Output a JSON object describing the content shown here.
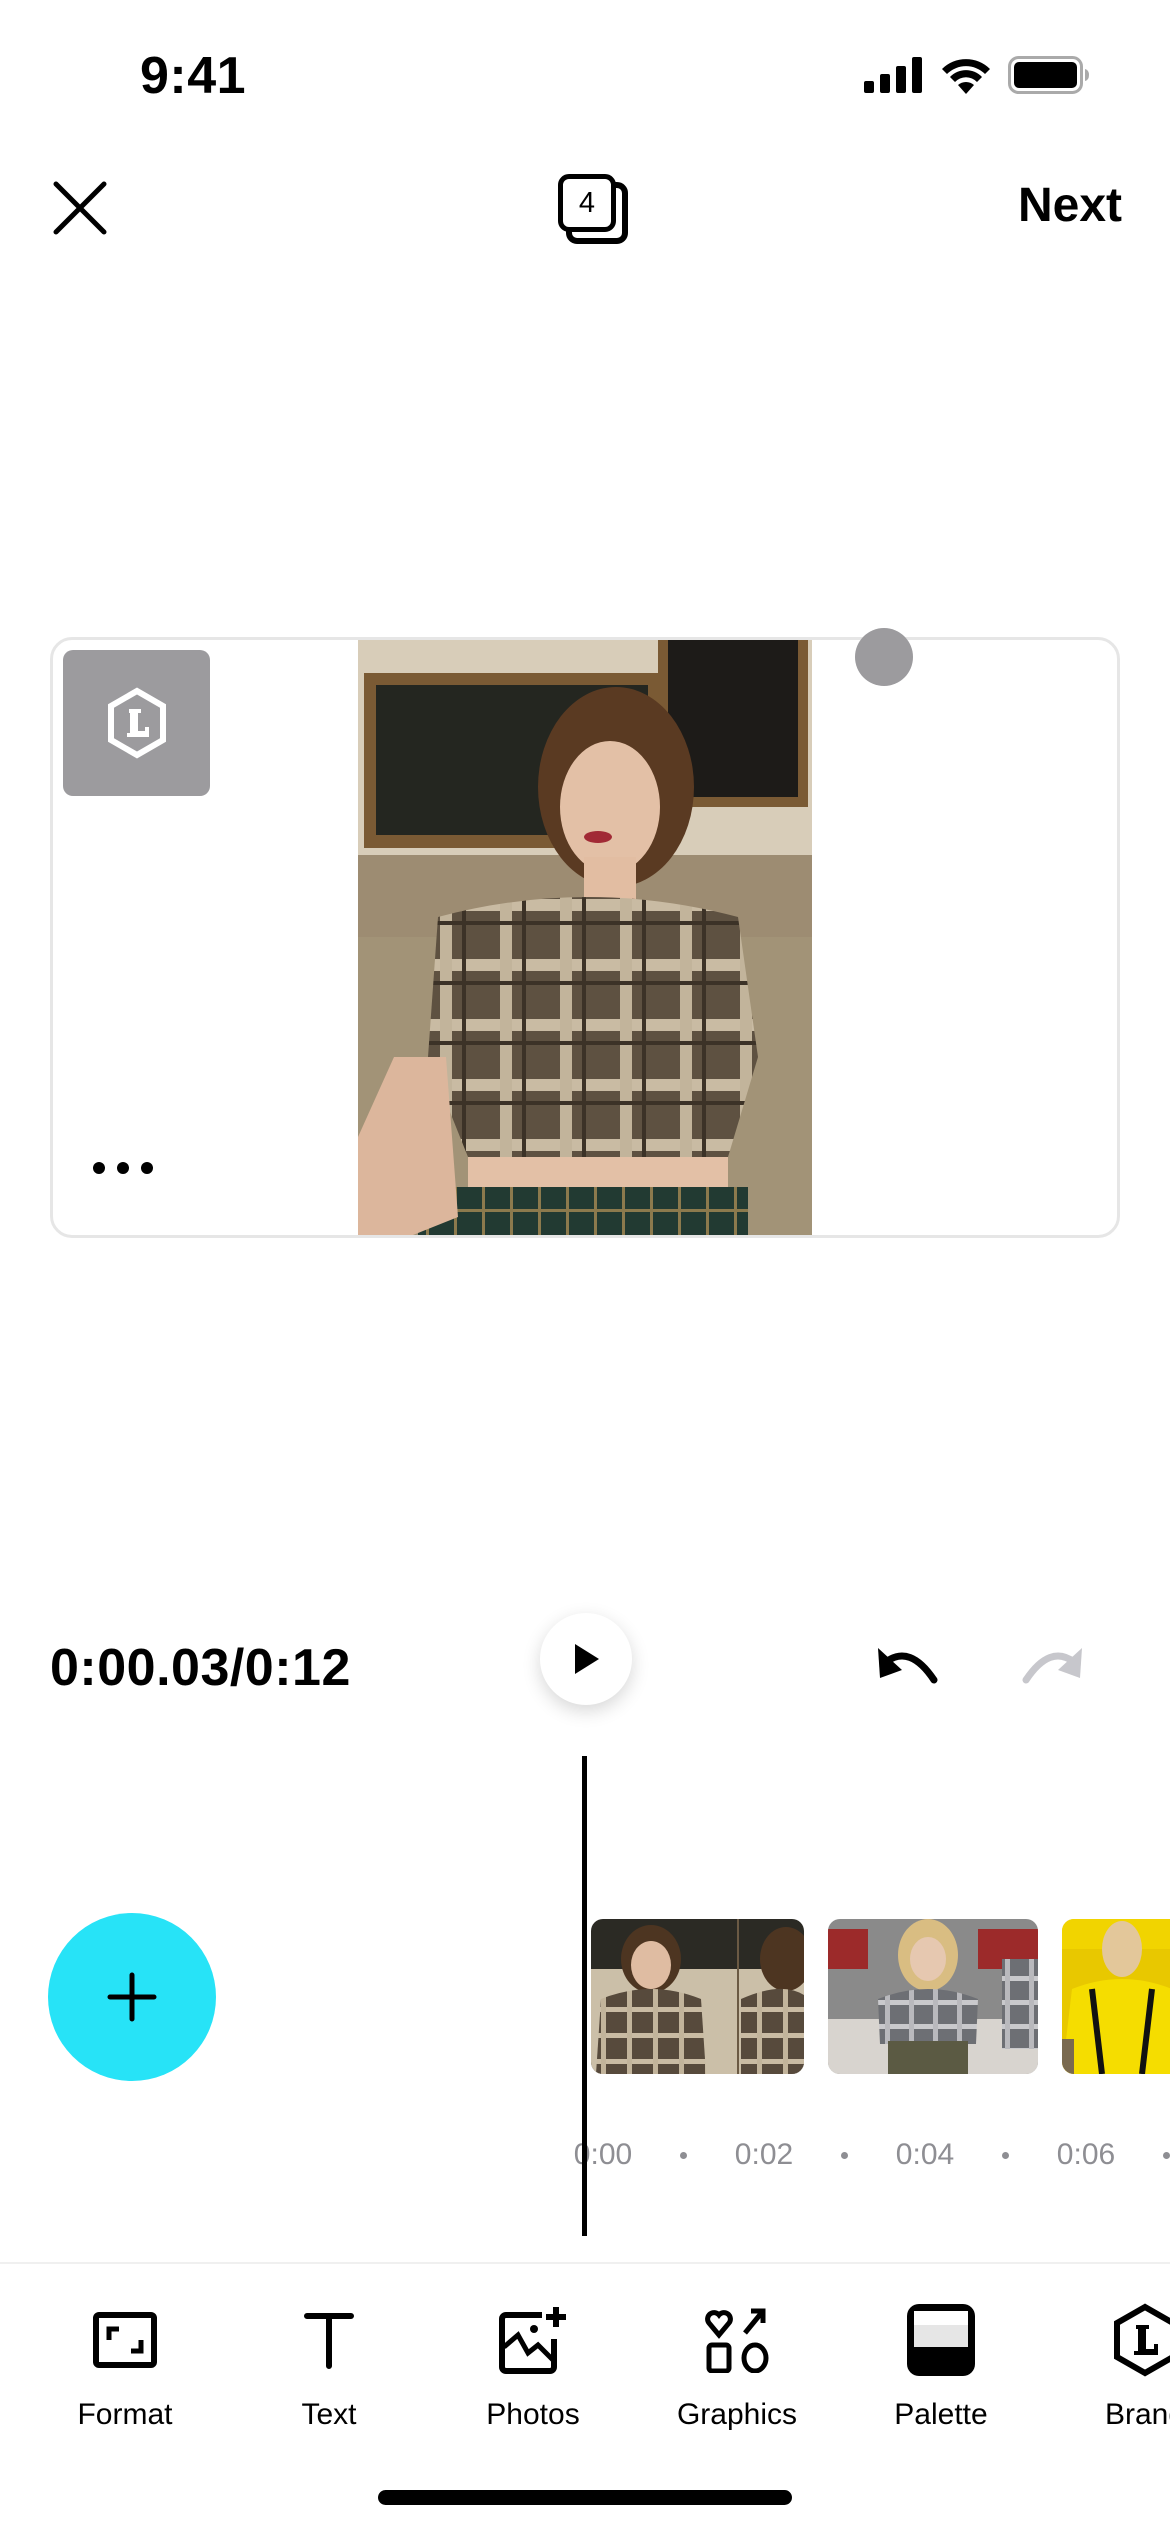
{
  "status_bar": {
    "time": "9:41"
  },
  "nav": {
    "close_icon": "close-icon",
    "layers_count": "4",
    "next_label": "Next"
  },
  "preview": {
    "logo_icon": "brand-hexagon-L-icon",
    "more_icon": "more-horizontal-icon",
    "image_alt": "Woman in brown plaid cropped shirt seated on a beige sofa"
  },
  "playback": {
    "current_time": "0:00.03",
    "total_time": "0:12",
    "time_display": "0:00.03/0:12",
    "play_icon": "play-icon",
    "undo_icon": "undo-icon",
    "redo_icon": "redo-icon",
    "redo_enabled": false
  },
  "timeline": {
    "add_icon": "plus-icon",
    "add_color": "#27e3f7",
    "clips": [
      {
        "name": "clip-1",
        "description": "Woman in brown plaid shirt"
      },
      {
        "name": "clip-2",
        "description": "Blonde woman in grey plaid shirt"
      },
      {
        "name": "clip-3",
        "description": "Woman in yellow jumpsuit"
      }
    ],
    "ticks": [
      "0:00",
      "0:02",
      "0:04",
      "0:06"
    ]
  },
  "toolbar": {
    "items": [
      {
        "label": "Format",
        "icon": "format-icon"
      },
      {
        "label": "Text",
        "icon": "text-icon"
      },
      {
        "label": "Photos",
        "icon": "photos-add-icon"
      },
      {
        "label": "Graphics",
        "icon": "graphics-icon"
      },
      {
        "label": "Palette",
        "icon": "palette-icon"
      },
      {
        "label": "Brand",
        "icon": "brand-icon"
      }
    ]
  }
}
